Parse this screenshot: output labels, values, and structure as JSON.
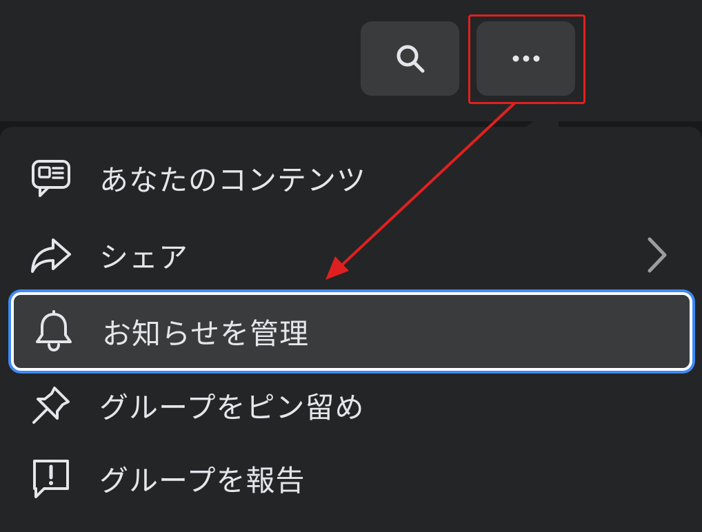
{
  "header": {
    "search_icon": "search-icon",
    "more_icon": "more-horizontal-icon"
  },
  "menu": {
    "items": [
      {
        "id": "content",
        "label": "あなたのコンテンツ",
        "icon": "content-feed-icon"
      },
      {
        "id": "share",
        "label": "シェア",
        "icon": "share-arrow-icon",
        "has_submenu": true
      },
      {
        "id": "notify",
        "label": "お知らせを管理",
        "icon": "bell-icon",
        "focused": true
      },
      {
        "id": "pin",
        "label": "グループをピン留め",
        "icon": "pin-icon"
      },
      {
        "id": "report",
        "label": "グループを報告",
        "icon": "report-flag-icon"
      }
    ]
  },
  "colors": {
    "background": "#242526",
    "button": "#3a3b3c",
    "text": "#e4e6eb",
    "annotation_red": "#e02020",
    "focus_blue": "#3d8af7"
  }
}
